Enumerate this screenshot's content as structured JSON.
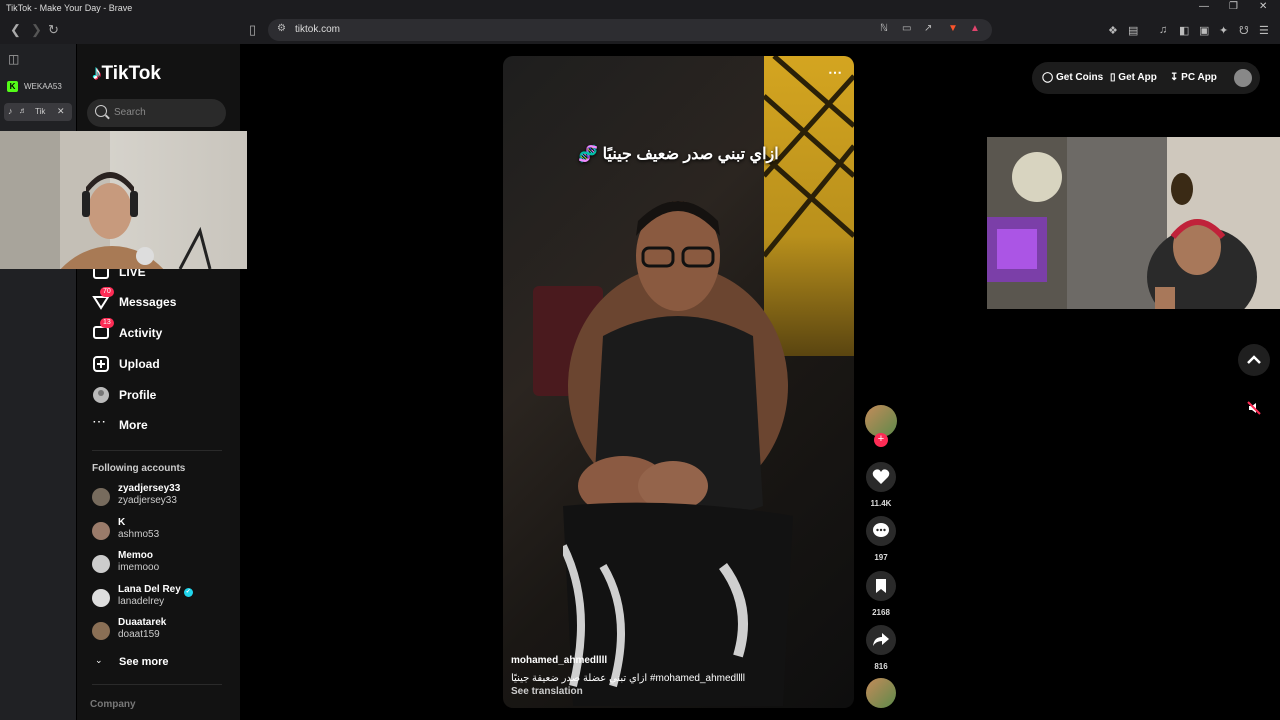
{
  "window": {
    "title": "TikTok - Make Your Day - Brave"
  },
  "address_bar": {
    "url": "tiktok.com"
  },
  "vertical_tabs": [
    {
      "label": "WEKAA53"
    },
    {
      "label": "Tik",
      "active": true
    }
  ],
  "sidebar": {
    "logo": "TikTok",
    "search_placeholder": "Search",
    "menu": [
      {
        "label": "LIVE",
        "icon": "live-icon"
      },
      {
        "label": "Messages",
        "icon": "messages-icon",
        "badge": "70"
      },
      {
        "label": "Activity",
        "icon": "activity-icon",
        "badge": "13"
      },
      {
        "label": "Upload",
        "icon": "upload-icon"
      },
      {
        "label": "Profile",
        "icon": "profile-icon"
      },
      {
        "label": "More",
        "icon": "more-icon"
      }
    ],
    "following_title": "Following accounts",
    "accounts": [
      {
        "name": "zyadjersey33",
        "handle": "zyadjersey33"
      },
      {
        "name": "K",
        "handle": "ashmo53"
      },
      {
        "name": "Memoo",
        "handle": "imemooo"
      },
      {
        "name": "Lana Del Rey",
        "handle": "lanadelrey",
        "verified": true
      },
      {
        "name": "Duaatarek",
        "handle": "doaat159"
      }
    ],
    "see_more": "See more",
    "company": "Company"
  },
  "video": {
    "overlay_text": "ازاي تبني صدر ضعيف جينيًا 🧬",
    "author": "mohamed_ahmedllll",
    "caption": "ازاي تبني عضلة صدر ضعيفة جينيًا #mohamed_ahmedllll",
    "see_translation": "See translation"
  },
  "actions": {
    "likes": "11.4K",
    "comments": "197",
    "saves": "2168",
    "shares": "816"
  },
  "top_right": {
    "get_coins": "Get Coins",
    "get_app": "Get App",
    "pc_app": "PC App"
  },
  "colors": {
    "accent": "#fe2c55",
    "verified": "#20d5ec",
    "wall": "#d4a520"
  }
}
